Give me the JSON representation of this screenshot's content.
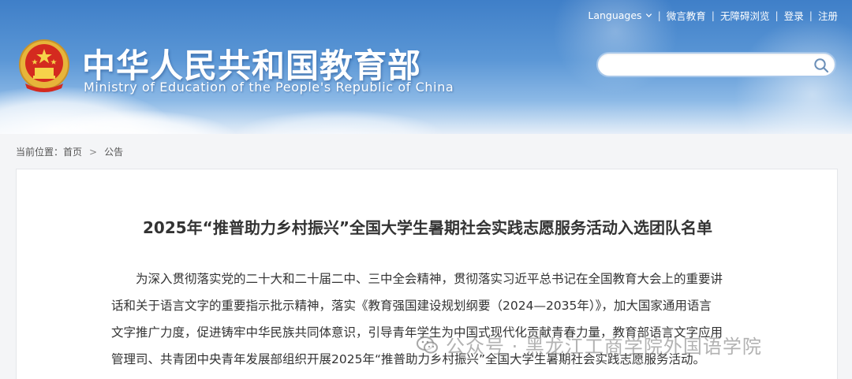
{
  "header": {
    "site_title": "中华人民共和国教育部",
    "site_subtitle": "Ministry of Education of the People's Republic of China",
    "emblem_icon": "national-emblem-icon",
    "colors": {
      "banner_top": "#3f7fc8",
      "banner_bottom": "#e6eef8",
      "title_text": "#ffffff"
    }
  },
  "topnav": {
    "languages": "Languages",
    "weiyan": "微言教育",
    "accessible": "无障碍浏览",
    "login": "登录",
    "register": "注册",
    "separator": "|",
    "chevron_icon": "chevron-down-icon"
  },
  "search": {
    "placeholder": "",
    "icon": "search-icon"
  },
  "breadcrumb": {
    "prefix": "当前位置：",
    "home": "首页",
    "arrow": ">",
    "current": "公告"
  },
  "article": {
    "title": "2025年“推普助力乡村振兴”全国大学生暑期社会实践志愿服务活动入选团队名单",
    "lines": [
      "为深入贯彻落实党的二十大和二十届二中、三中全会精神，贯彻落实习近平总书记在全国教育大会上的重要讲",
      "话和关于语言文字的重要指示批示精神，落实《教育强国建设规划纲要（2024—2035年）》，加大国家通用语言",
      "文字推广力度，促进铸牢中华民族共同体意识，引导青年学生为中国式现代化贡献青春力量，教育部语言文字应用",
      "管理司、共青团中央青年发展部组织开展2025年“推普助力乡村振兴”全国大学生暑期社会实践志愿服务活动。"
    ]
  },
  "watermark": {
    "text": "公众号 · 黑龙江工商学院外国语学院",
    "icon": "wechat-icon"
  }
}
